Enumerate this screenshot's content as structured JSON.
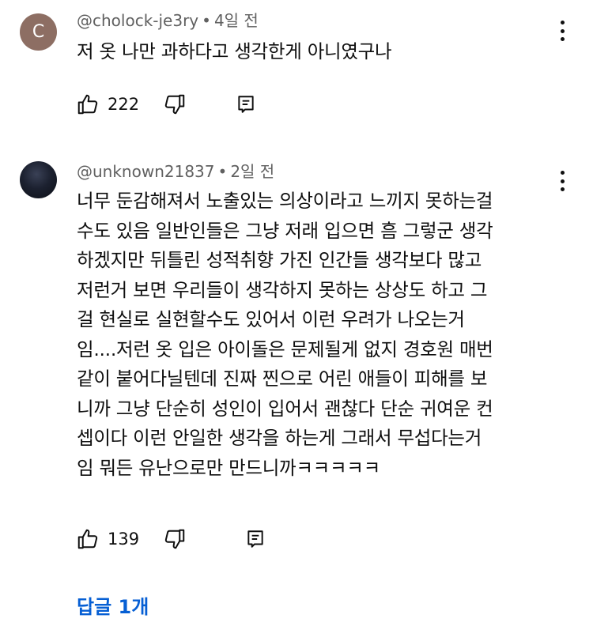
{
  "comments": [
    {
      "author": "@cholock-je3ry",
      "time": "4일 전",
      "avatar_letter": "C",
      "text": "저 옷 나만 과하다고 생각한게 아니였구나",
      "likes": "222"
    },
    {
      "author": "@unknown21837",
      "time": "2일 전",
      "text": "너무 둔감해져서 노출있는 의상이라고 느끼지 못하는걸\n수도 있음 일반인들은 그냥 저래 입으면 흠 그렇군 생각\n하겠지만 뒤틀린 성적취향 가진 인간들 생각보다 많고\n저런거 보면 우리들이 생각하지 못하는 상상도 하고 그\n걸 현실로 실현할수도 있어서 이런 우려가 나오는거\n임....저런 옷 입은 아이돌은 문제될게 없지 경호원 매번\n같이 붙어다닐텐데 진짜 찐으로 어린 애들이 피해를 보\n니까 그냥 단순히 성인이 입어서 괜찮다 단순 귀여운 컨\n셉이다 이런 안일한 생각을 하는게 그래서 무섭다는거\n임 뭐든 유난으로만 만드니까ㅋㅋㅋㅋㅋ",
      "likes": "139"
    }
  ],
  "separator": "•",
  "replies_label": "답글 1개",
  "colors": {
    "meta": "#606060",
    "text": "#0f0f0f",
    "link": "#065fd4",
    "avatar_c": "#8d6e63"
  },
  "icons": [
    "more-vertical-icon",
    "thumbs-up-icon",
    "thumbs-down-icon",
    "reply-comment-icon"
  ]
}
